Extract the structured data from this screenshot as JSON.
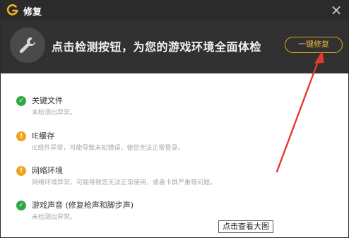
{
  "window": {
    "title": "修复",
    "close_glyph": "×",
    "logo_icon": "g-logo-icon"
  },
  "header": {
    "icon": "wrench-icon",
    "text": "点击检测按钮，为您的游戏环境全面体检",
    "button_label": "一键修复"
  },
  "items": [
    {
      "status": "ok",
      "icon_glyph": "✓",
      "title": "关键文件",
      "desc": "未检测出异常。"
    },
    {
      "status": "warn",
      "icon_glyph": "!",
      "title": "IE缓存",
      "desc": "IE组件异常，可能导致未知错误，使您无法正常登录。"
    },
    {
      "status": "warn",
      "icon_glyph": "!",
      "title": "网络环境",
      "desc": "网络环境异常，可能导致您无法正常使用，或者卡屏严重等问题。"
    },
    {
      "status": "ok",
      "icon_glyph": "✓",
      "title": "游戏声音 (修复枪声和脚步声)",
      "desc": "未检测出异常。"
    }
  ],
  "tooltip": {
    "text": "点击查看大图"
  },
  "colors": {
    "accent": "#e0a21d",
    "ok": "#32a845",
    "warn": "#f0a325",
    "annotation_arrow": "#e23a2f"
  }
}
